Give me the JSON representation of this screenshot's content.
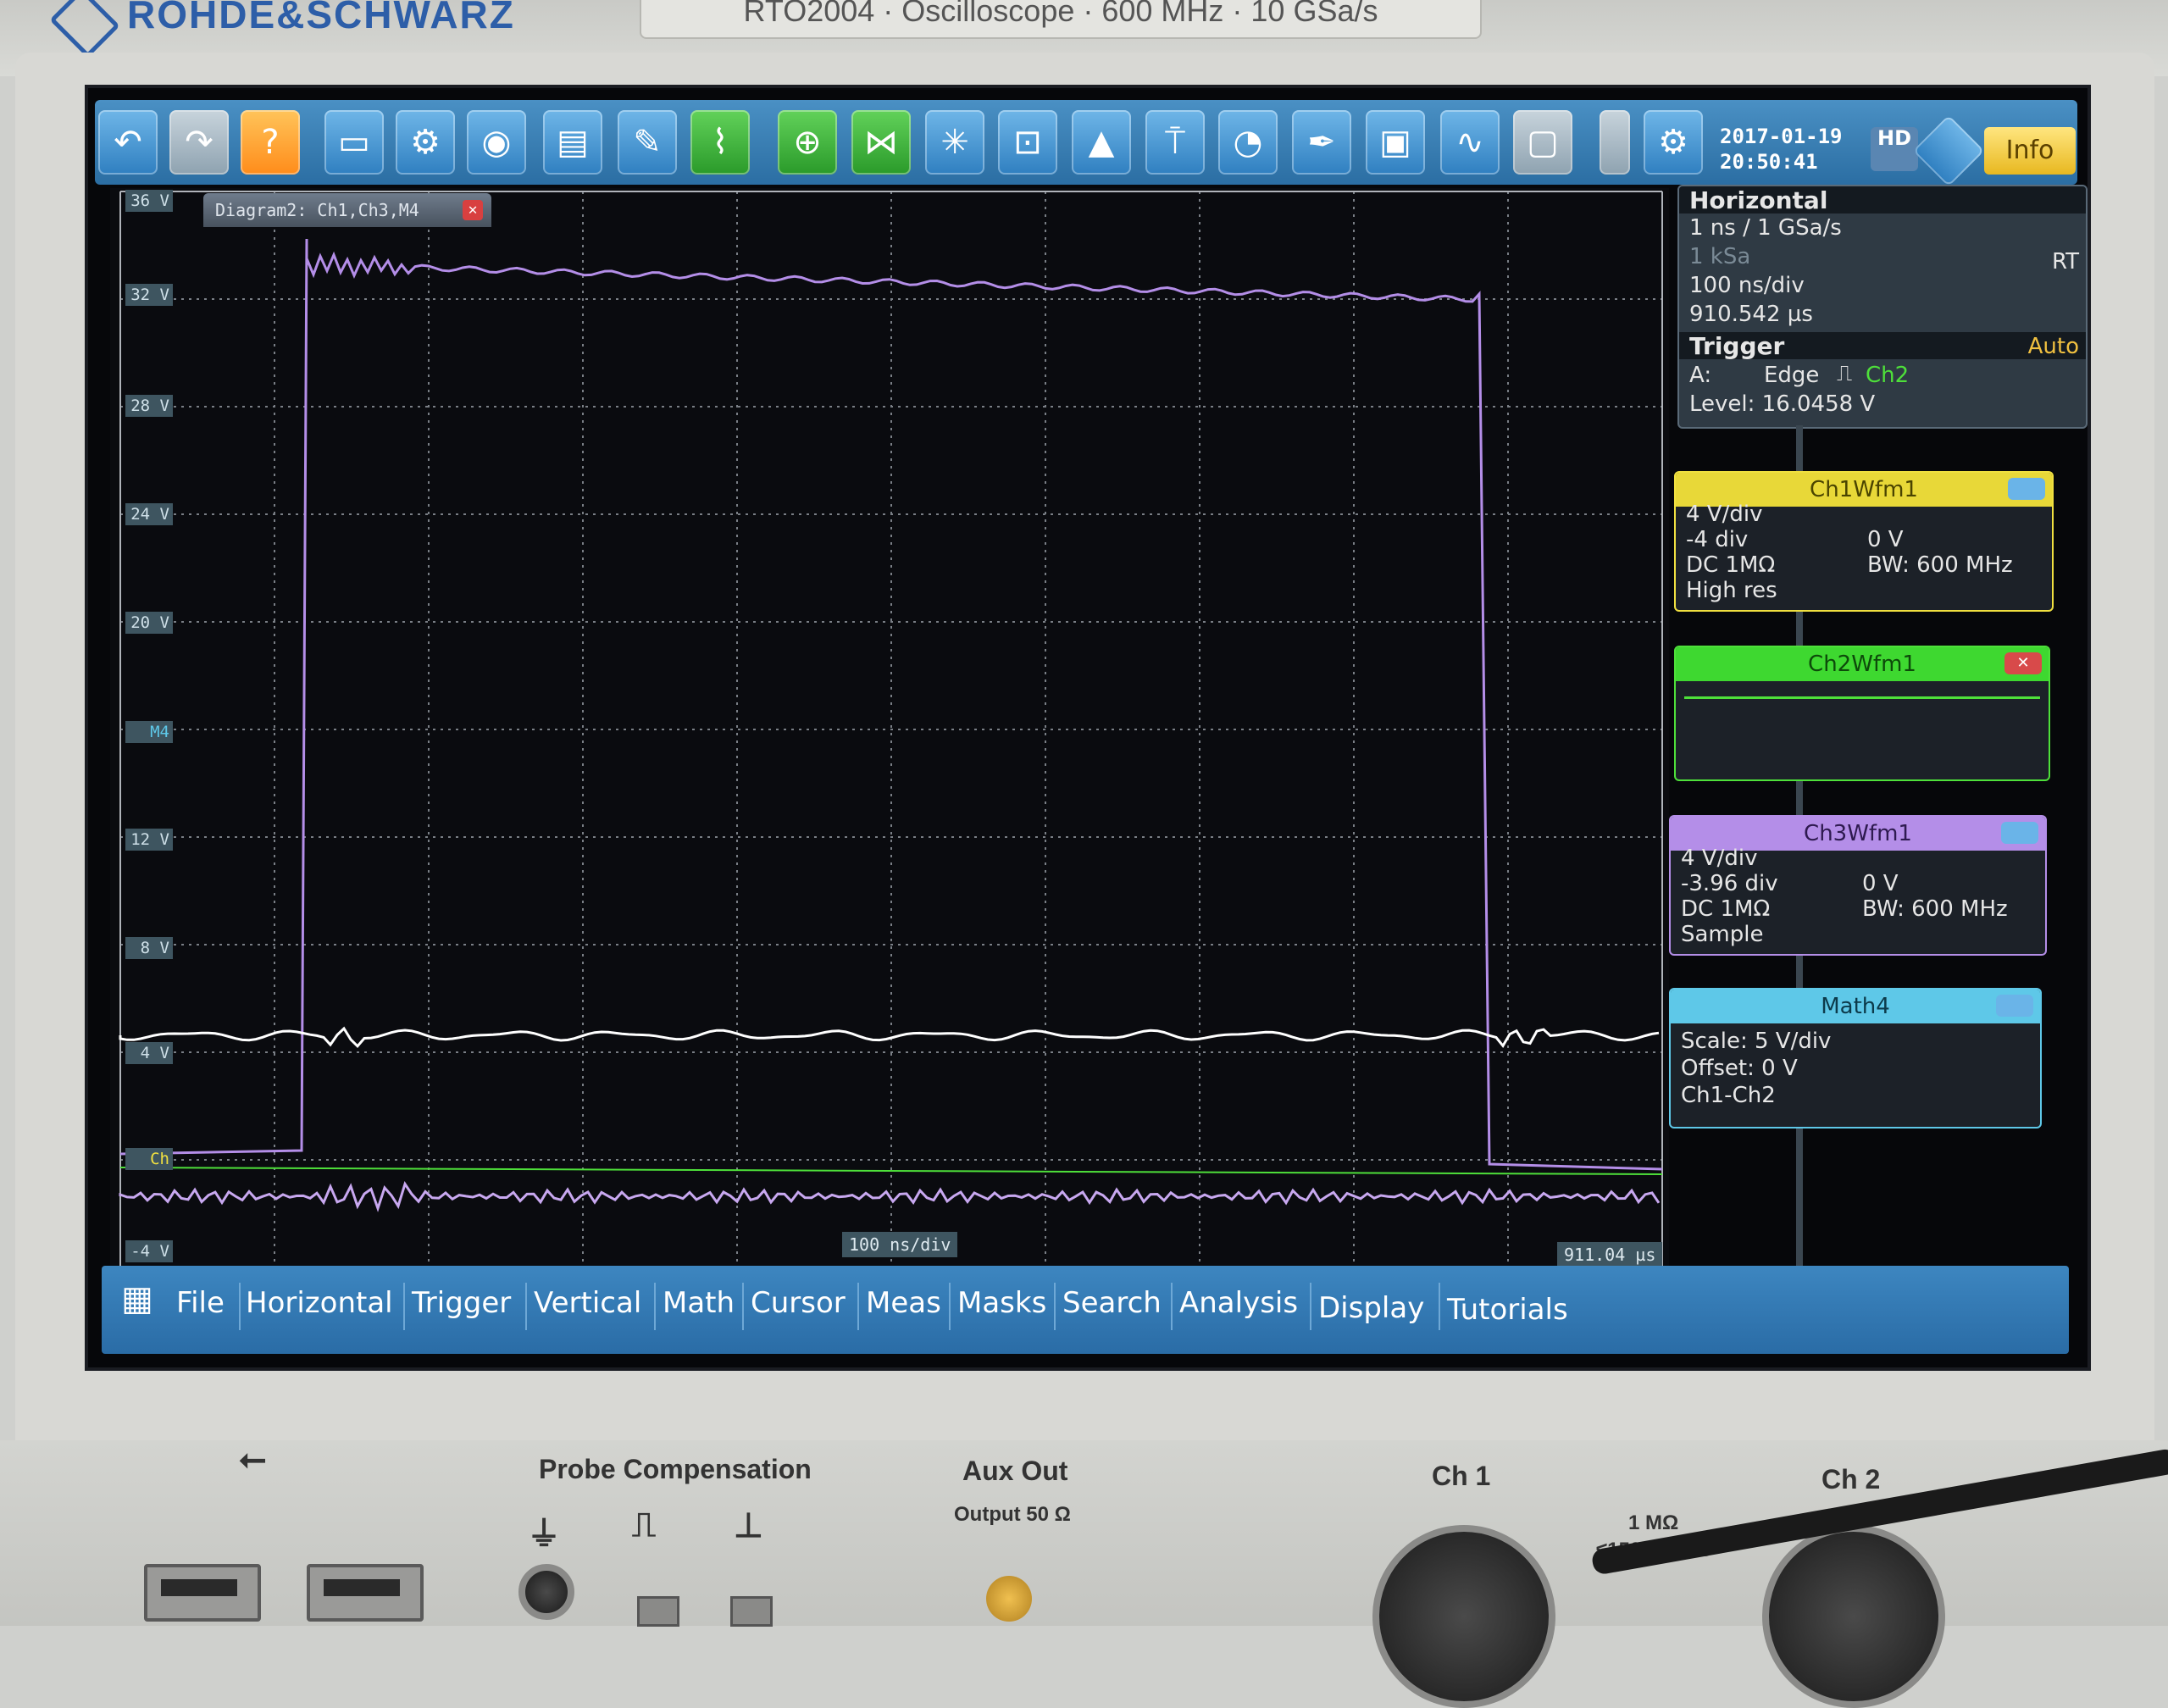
{
  "device": {
    "brand": "ROHDE&SCHWARZ",
    "model_plate": "RTO2004 · Oscilloscope · 600 MHz · 10 GSa/s"
  },
  "toolbar": {
    "icons": [
      "undo-icon",
      "redo-icon",
      "help-icon",
      "open-folder-icon",
      "save-setup-icon",
      "screenshot-icon",
      "report-icon",
      "clear-icon",
      "autoset-icon",
      "zoom-icon",
      "binoculars-icon",
      "fft-icon",
      "mask-icon",
      "histogram-icon",
      "marker-icon",
      "measure-icon",
      "probe-icon",
      "save-waveform-icon",
      "spectrum-icon",
      "display-icon",
      "settings-icon"
    ],
    "date": "2017-01-19",
    "time": "20:50:41",
    "hd_label": "HD",
    "info_label": "Info"
  },
  "diagram": {
    "tab_title": "Diagram2: Ch1,Ch3,M4",
    "y_labels": [
      "36 V",
      "32 V",
      "28 V",
      "24 V",
      "20 V",
      "M4",
      "12 V",
      "8 V",
      "4 V",
      "Ch",
      "-4 V"
    ],
    "timebase_label": "100 ns/div",
    "time_position_label": "911.04 µs"
  },
  "horizontal": {
    "title": "Horizontal",
    "resolution": "1 ns / 1 GSa/s",
    "record_length": "1 kSa",
    "mode": "RT",
    "time_scale": "100 ns/div",
    "position": "910.542 µs"
  },
  "trigger": {
    "title": "Trigger",
    "mode": "Auto",
    "source_label": "A:",
    "type": "Edge",
    "source": "Ch2",
    "level": "Level: 16.0458 V"
  },
  "ch1": {
    "title": "Ch1Wfm1",
    "scale": "4 V/div",
    "offset_div": "-4 div",
    "offset_v": "0 V",
    "coupling": "DC 1MΩ",
    "bandwidth": "BW: 600 MHz",
    "acq": "High res",
    "color": "#f0e040"
  },
  "ch2": {
    "title": "Ch2Wfm1",
    "color": "#4ee03a"
  },
  "ch3": {
    "title": "Ch3Wfm1",
    "scale": "4 V/div",
    "offset_div": "-3.96 div",
    "offset_v": "0 V",
    "coupling": "DC 1MΩ",
    "bandwidth": "BW: 600 MHz",
    "acq": "Sample",
    "color": "#b48ee8"
  },
  "math4": {
    "title": "Math4",
    "scale": "Scale:  5 V/div",
    "offset": "Offset: 0 V",
    "expr": "Ch1-Ch2",
    "color": "#5ec8e8"
  },
  "menu": [
    "File",
    "Horizontal",
    "Trigger",
    "Vertical",
    "Math",
    "Cursor",
    "Meas",
    "Masks",
    "Search",
    "Analysis",
    "Display",
    "Tutorials"
  ],
  "front_panel": {
    "probe_comp": "Probe Compensation",
    "aux_out": "Aux Out",
    "aux_out_sub": "Output 50 Ω",
    "ch1": "Ch 1",
    "ch2": "Ch 2",
    "input_spec_1": "1 MΩ",
    "input_spec_2": "≤150 V RMS"
  }
}
